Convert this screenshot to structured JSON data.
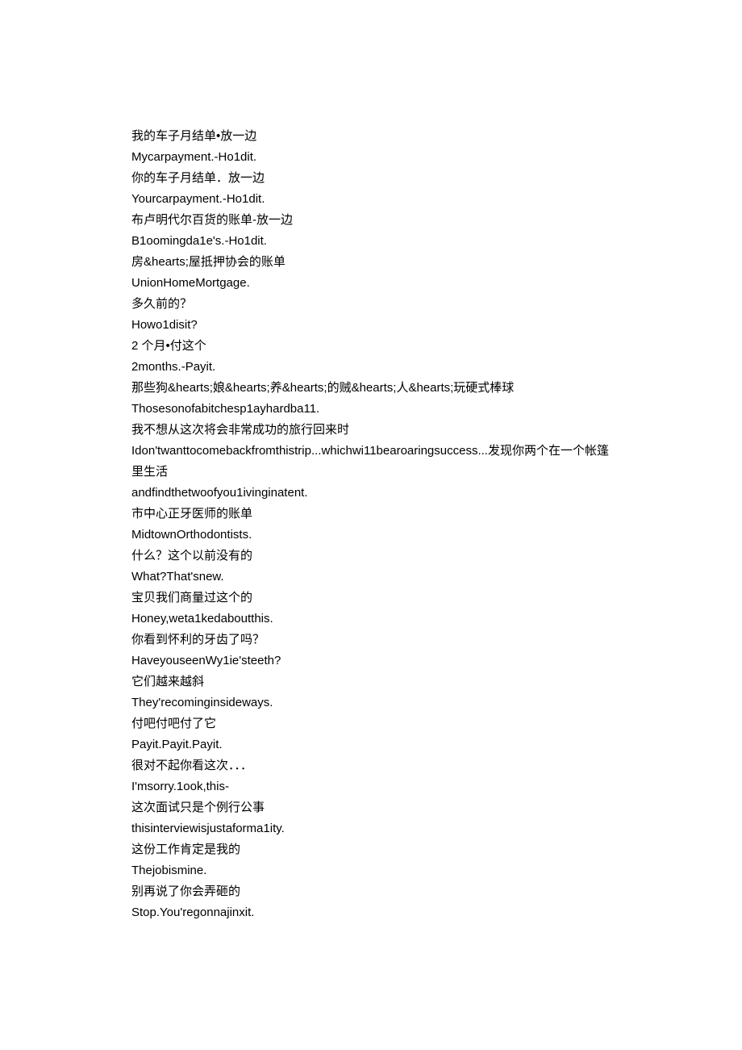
{
  "lines": [
    "我的车子月结单•放一边",
    "Mycarpayment.-Ho1dit.",
    "你的车子月结单．放一边",
    "Yourcarpayment.-Ho1dit.",
    "布卢明代尔百货的账单-放一边",
    "B1oomingda1e's.-Ho1dit.",
    "房&hearts;屋抵押协会的账单",
    "UnionHomeMortgage.",
    "多久前的？",
    "Howo1disit?",
    "2 个月•付这个",
    "2months.-Payit.",
    "那些狗&hearts;娘&hearts;养&hearts;的贼&hearts;人&hearts;玩硬式棒球",
    "Thosesonofabitchesp1ayhardba11.",
    "我不想从这次将会非常成功的旅行回来时",
    "Idon'twanttocomebackfromthistrip...whichwi11bearoaringsuccess...发现你两个在一个帐篷里生活",
    "andfindthetwoofyou1ivinginatent.",
    "市中心正牙医师的账单",
    "MidtownOrthodontists.",
    "什么？这个以前没有的",
    "What?That'snew.",
    "宝贝我们商量过这个的",
    "Honey,weta1kedaboutthis.",
    "你看到怀利的牙齿了吗？",
    "HaveyouseenWy1ie'steeth?",
    "它们越来越斜",
    "They'recominginsideways.",
    "付吧付吧付了它",
    "Payit.Payit.Payit.",
    "很对不起你看这次．．．",
    "I'msorry.1ook,this-",
    "这次面试只是个例行公事",
    "thisinterviewisjustaforma1ity.",
    "这份工作肯定是我的",
    "Thejobismine.",
    "别再说了你会弄砸的",
    "Stop.You'regonnajinxit."
  ]
}
